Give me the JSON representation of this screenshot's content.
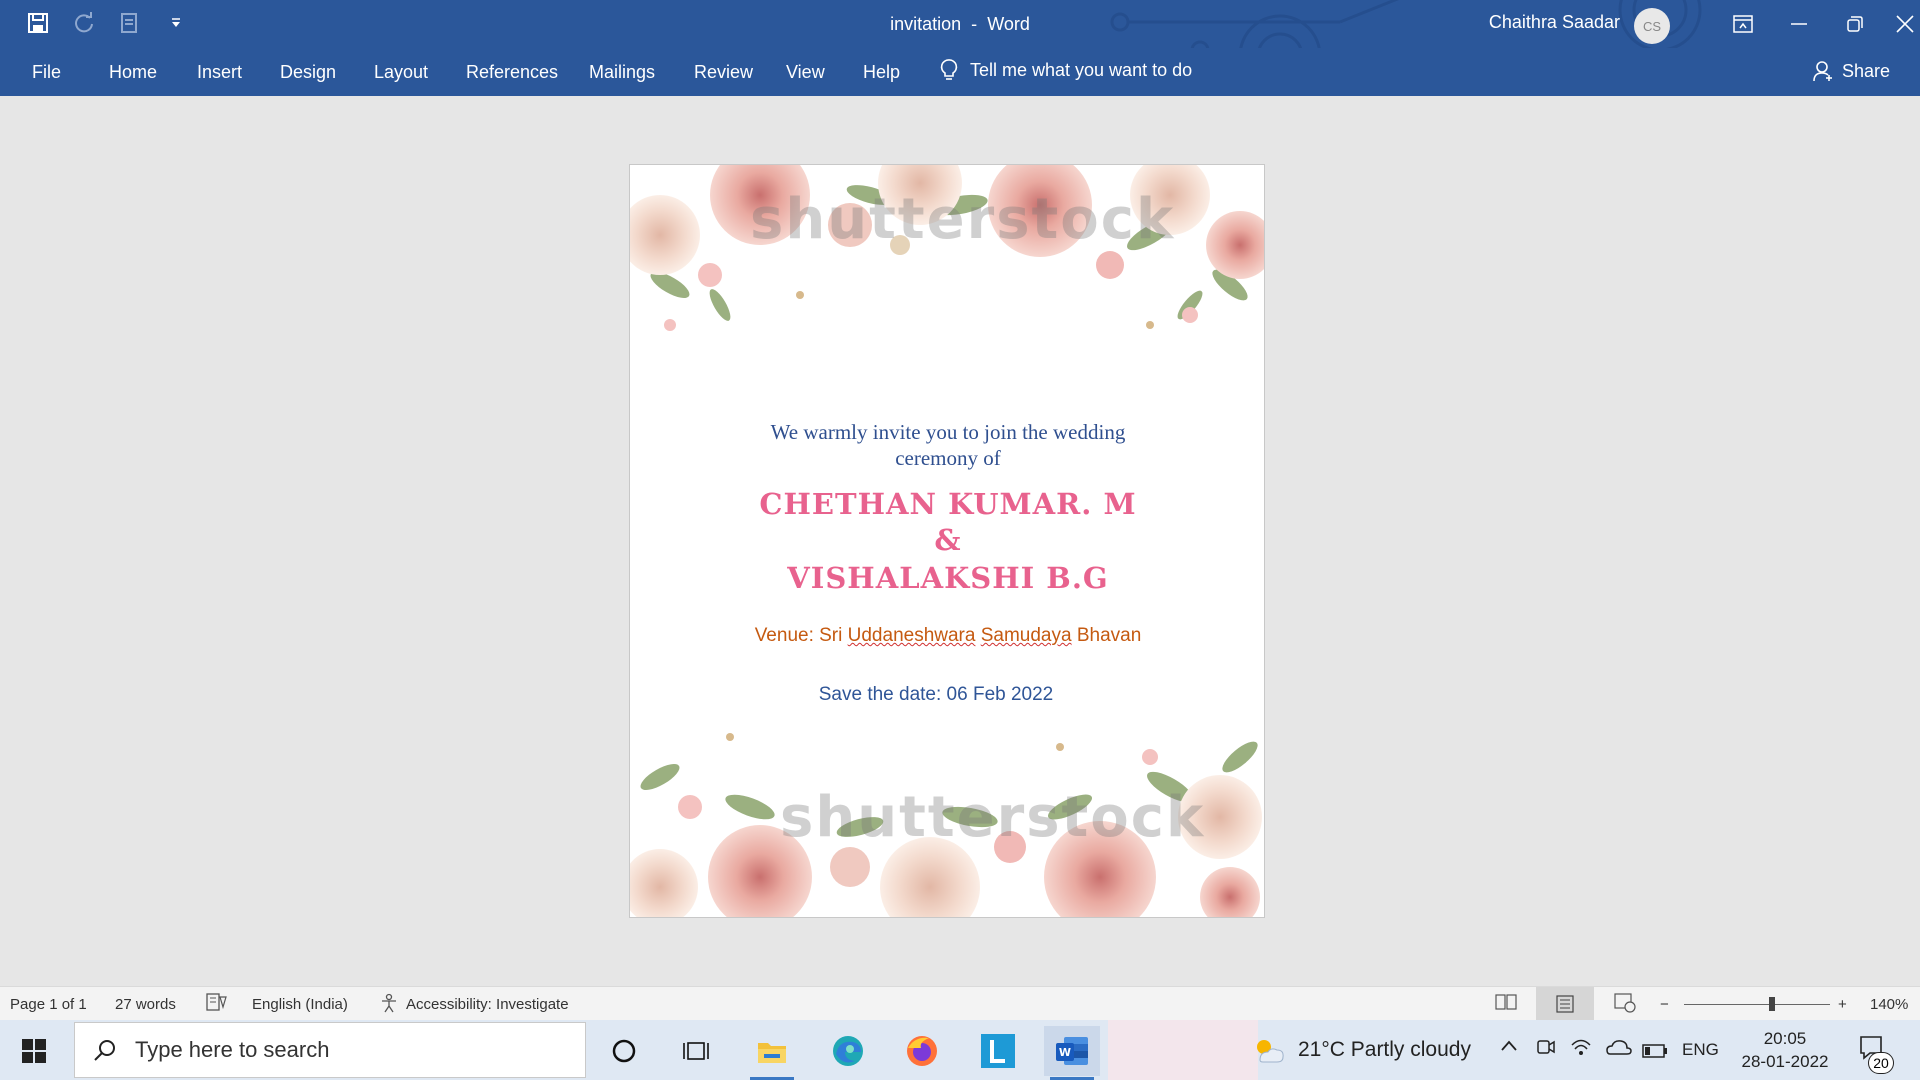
{
  "window": {
    "doc_name": "invitation",
    "separator": "-",
    "app_name": "Word",
    "user_name": "Chaithra Saadar",
    "user_initials": "CS"
  },
  "menu": {
    "items": [
      "File",
      "Home",
      "Insert",
      "Design",
      "Layout",
      "References",
      "Mailings",
      "Review",
      "View",
      "Help"
    ],
    "tell_me": "Tell me what you want to do",
    "share": "Share"
  },
  "document": {
    "intro_line1": "We warmly invite you to join the wedding",
    "intro_line2": "ceremony of",
    "groom": "CHETHAN KUMAR. M",
    "ampersand": "&",
    "bride": "VISHALAKSHI B.G",
    "venue_prefix": "Venue: Sri",
    "venue_word1": "Uddaneshwara",
    "venue_word2": "Samudaya",
    "venue_suffix": "Bhavan",
    "save_date": "Save the date:  06 Feb 2022",
    "watermark_top": "shutterstock",
    "watermark_bottom": "shutterstock"
  },
  "status": {
    "page": "Page 1 of 1",
    "words": "27 words",
    "language": "English (India)",
    "accessibility": "Accessibility: Investigate",
    "zoom": "140%",
    "zoom_level": 0.6
  },
  "taskbar": {
    "search_placeholder": "Type here to search",
    "weather": "21°C  Partly cloudy",
    "lang": "ENG",
    "time": "20:05",
    "date": "28-01-2022",
    "notifications": "20"
  },
  "colors": {
    "accent": "#2b579a",
    "names": "#e8628e",
    "venue": "#c55a11",
    "date": "#2f5597"
  }
}
